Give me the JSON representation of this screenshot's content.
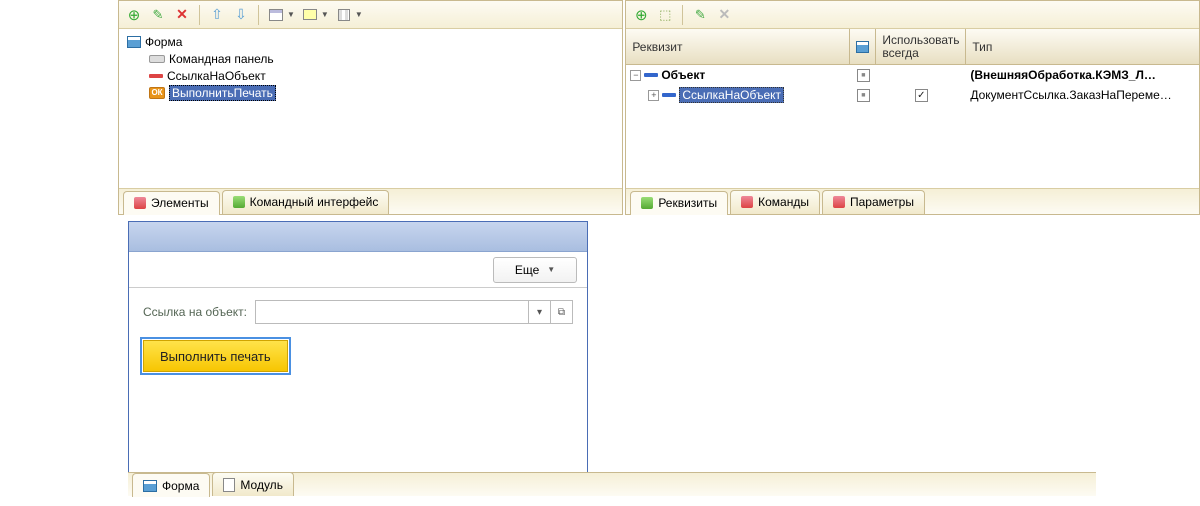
{
  "left": {
    "tree": {
      "root": "Форма",
      "items": [
        "Командная панель",
        "СсылкаНаОбъект",
        "ВыполнитьПечать"
      ],
      "ok_badge": "ОК"
    },
    "tabs": {
      "elements": "Элементы",
      "cmdint": "Командный интерфейс"
    }
  },
  "right": {
    "headers": {
      "req": "Реквизит",
      "use_always": "Использовать всегда",
      "type": "Тип"
    },
    "rows": [
      {
        "name": "Объект",
        "type": "(ВнешняяОбработка.КЭМЗ_Л…",
        "bold": true,
        "expanded": true,
        "level": 0,
        "chk2": "partial",
        "chk3": ""
      },
      {
        "name": "СсылкаНаОбъект",
        "type": "ДокументСсылка.ЗаказНаПереме…",
        "bold": false,
        "expanded": false,
        "level": 1,
        "chk2": "partial",
        "chk3": "checked",
        "selected": true
      }
    ],
    "tabs": {
      "req": "Реквизиты",
      "cmd": "Команды",
      "param": "Параметры"
    }
  },
  "preview": {
    "more": "Еще",
    "field_label": "Ссылка на объект:",
    "button": "Выполнить печать"
  },
  "bottom_tabs": {
    "form": "Форма",
    "module": "Модуль"
  }
}
